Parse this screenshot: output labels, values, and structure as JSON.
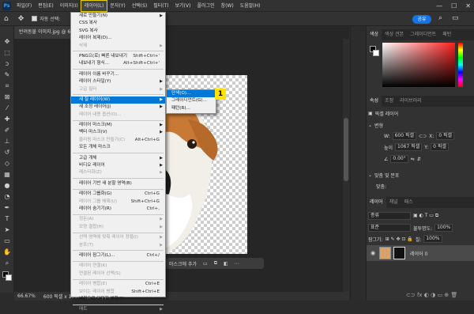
{
  "app": {
    "logo": "Ps"
  },
  "menubar": {
    "items": [
      "파일(F)",
      "편집(E)",
      "이미지(I)",
      "레이어(L)",
      "문자(Y)",
      "선택(S)",
      "필터(T)",
      "보기(V)",
      "플러그인",
      "창(W)",
      "도움말(H)"
    ],
    "active_index": 3
  },
  "window_controls": {
    "minimize": "—",
    "maximize": "☐",
    "close": "✕"
  },
  "options_bar": {
    "home_icon": "⌂",
    "move_icon": "✥",
    "autoselect_label": "자동 선택:",
    "share_label": "공유"
  },
  "document": {
    "tab_title": "반려동물 이미지.jpg @ 6",
    "zoom": "66.67%",
    "info": "600 픽셀 x 1067 픽셀 (72 ppi)"
  },
  "context_bar": {
    "label": "마스크에 추가"
  },
  "layer_menu": {
    "items": [
      {
        "label": "새로 만들기(N)",
        "arrow": true
      },
      {
        "label": "CSS 복사"
      },
      {
        "label": "SVG 복사"
      },
      {
        "label": "레이어 복제(D)..."
      },
      {
        "label": "삭제",
        "disabled": true,
        "arrow": true
      },
      {
        "sep": true
      },
      {
        "label": "PNG으(로) 빠른 내보내기",
        "shortcut": "Shift+Ctrl+'"
      },
      {
        "label": "내보내기 형식...",
        "shortcut": "Alt+Shift+Ctrl+'"
      },
      {
        "sep": true
      },
      {
        "label": "레이어 이름 바꾸기..."
      },
      {
        "label": "레이어 스타일(Y)",
        "arrow": true
      },
      {
        "label": "고급 필터",
        "disabled": true,
        "arrow": true
      },
      {
        "sep": true
      },
      {
        "label": "새 칠 레이어(W)",
        "arrow": true,
        "highlighted": true
      },
      {
        "label": "새 조정 레이어(J)",
        "arrow": true
      },
      {
        "label": "레이어 내용 옵션(O)...",
        "disabled": true
      },
      {
        "sep": true
      },
      {
        "label": "레이어 마스크(M)",
        "arrow": true
      },
      {
        "label": "벡터 마스크(V)",
        "arrow": true
      },
      {
        "label": "클리핑 마스크 만들기(C)",
        "shortcut": "Alt+Ctrl+G",
        "disabled": true
      },
      {
        "label": "모든 개체 마스크"
      },
      {
        "sep": true
      },
      {
        "label": "고급 개체",
        "arrow": true
      },
      {
        "label": "비디오 레이어",
        "arrow": true
      },
      {
        "label": "래스터화(Z)",
        "disabled": true,
        "arrow": true
      },
      {
        "sep": true
      },
      {
        "label": "레이어 기반 새 분할 영역(B)"
      },
      {
        "sep": true
      },
      {
        "label": "레이어 그룹화(G)",
        "shortcut": "Ctrl+G"
      },
      {
        "label": "레이어 그룹 해제(U)",
        "shortcut": "Shift+Ctrl+G",
        "disabled": true
      },
      {
        "label": "레이어 숨기기(R)",
        "shortcut": "Ctrl+,"
      },
      {
        "sep": true
      },
      {
        "label": "정돈(A)",
        "disabled": true,
        "arrow": true
      },
      {
        "label": "모양 결합(H)",
        "disabled": true,
        "arrow": true
      },
      {
        "sep": true
      },
      {
        "label": "선택 영역에 맞춰 레이어 정렬(I)",
        "disabled": true,
        "arrow": true
      },
      {
        "label": "분포(T)",
        "disabled": true,
        "arrow": true
      },
      {
        "sep": true
      },
      {
        "label": "레이어 잠그기(L)...",
        "shortcut": "Ctrl+/"
      },
      {
        "sep": true
      },
      {
        "label": "레이어 연결(K)",
        "disabled": true
      },
      {
        "label": "연결된 레이어 선택(S)",
        "disabled": true
      },
      {
        "sep": true
      },
      {
        "label": "레이어 병합(E)",
        "shortcut": "Ctrl+E",
        "disabled": true
      },
      {
        "label": "보이는 레이어 병합",
        "shortcut": "Shift+Ctrl+E",
        "disabled": true
      },
      {
        "label": "배경으로 이미지 병합(F)"
      },
      {
        "sep": true
      },
      {
        "label": "매트",
        "disabled": true,
        "arrow": true
      }
    ]
  },
  "fill_submenu": {
    "items": [
      {
        "label": "단색(O)...",
        "highlighted": true
      },
      {
        "label": "그레이디언트(G)..."
      },
      {
        "label": "패턴(R)..."
      }
    ]
  },
  "step_badge": "1",
  "right_panel": {
    "color_tabs": [
      "색상",
      "색상 견본",
      "그레이디언트",
      "패턴"
    ],
    "props_tabs": [
      "속성",
      "조정",
      "라이브러리"
    ],
    "pixel_layer_label": "픽셀 레이어",
    "transform_header": "변형",
    "w_label": "W:",
    "w_value": "600 픽셀",
    "h_label": "높이",
    "h_value": "1067 픽셀",
    "x_label": "X:",
    "x_value": "0 픽셀",
    "y_label": "Y:",
    "y_value": "0 픽셀",
    "angle_value": "0.00°",
    "align_header": "맞춤 및 분포",
    "align_sub": "맞춤:",
    "layers_tabs": [
      "레이어",
      "채널",
      "패스"
    ],
    "kind_label": "종류",
    "blend_mode": "표준",
    "opacity_label": "불투명도:",
    "opacity_value": "100%",
    "lock_label": "잠그기:",
    "fill_label": "칠:",
    "fill_value": "100%",
    "layer_name": "레이어 0"
  },
  "colors": {
    "accent": "#0078d7",
    "badge": "#ffe400",
    "share": "#1473e6"
  }
}
